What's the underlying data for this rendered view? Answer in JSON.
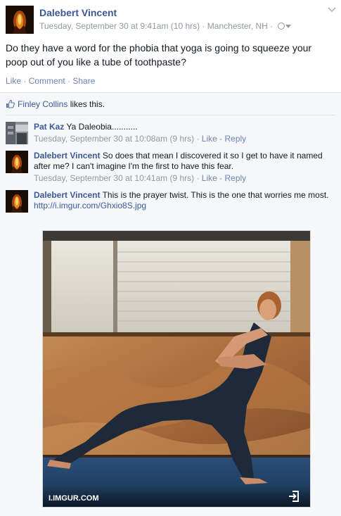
{
  "post": {
    "author": "Dalebert Vincent",
    "timestamp": "Tuesday, September 30 at 9:41am (10 hrs)",
    "location_sep": " · ",
    "location": "Manchester, NH",
    "privacy_sep": " · ",
    "text": "Do they have a word for the phobia that yoga is going to squeeze your poop out of you like a tube of toothpaste?",
    "actions": {
      "like": "Like",
      "sep1": " · ",
      "comment": "Comment",
      "sep2": " · ",
      "share": "Share"
    }
  },
  "likes": {
    "name": "Finley Collins",
    "suffix": " likes this."
  },
  "comments": [
    {
      "author": "Pat Kaz",
      "text": " Ya Daleobia...........",
      "timestamp": "Tuesday, September 30 at 10:08am (9 hrs)",
      "sep": " · ",
      "like": "Like",
      "dash": " - ",
      "reply": "Reply"
    },
    {
      "author": "Dalebert Vincent",
      "text": " So does that mean I discovered it so I get to have it named after me? I can't imagine I'm the first to have this fear.",
      "timestamp": "Tuesday, September 30 at 10:41am (9 hrs)",
      "sep": " · ",
      "like": "Like",
      "dash": " - ",
      "reply": "Reply"
    },
    {
      "author": "Dalebert Vincent",
      "text": " This is the prayer twist. This is the one that worries me most.",
      "link": "http://i.imgur.com/Ghxio8S.jpg"
    }
  ],
  "photo": {
    "source": "I.IMGUR.COM",
    "icon": "expand-icon"
  },
  "icons": [
    "chevron-down-icon",
    "globe-icon",
    "caret-down-icon",
    "thumbs-up-icon",
    "expand-icon"
  ],
  "colors": {
    "link": "#3b5998",
    "meta": "#9197a3",
    "ufi_bg": "#f6f7f8"
  }
}
